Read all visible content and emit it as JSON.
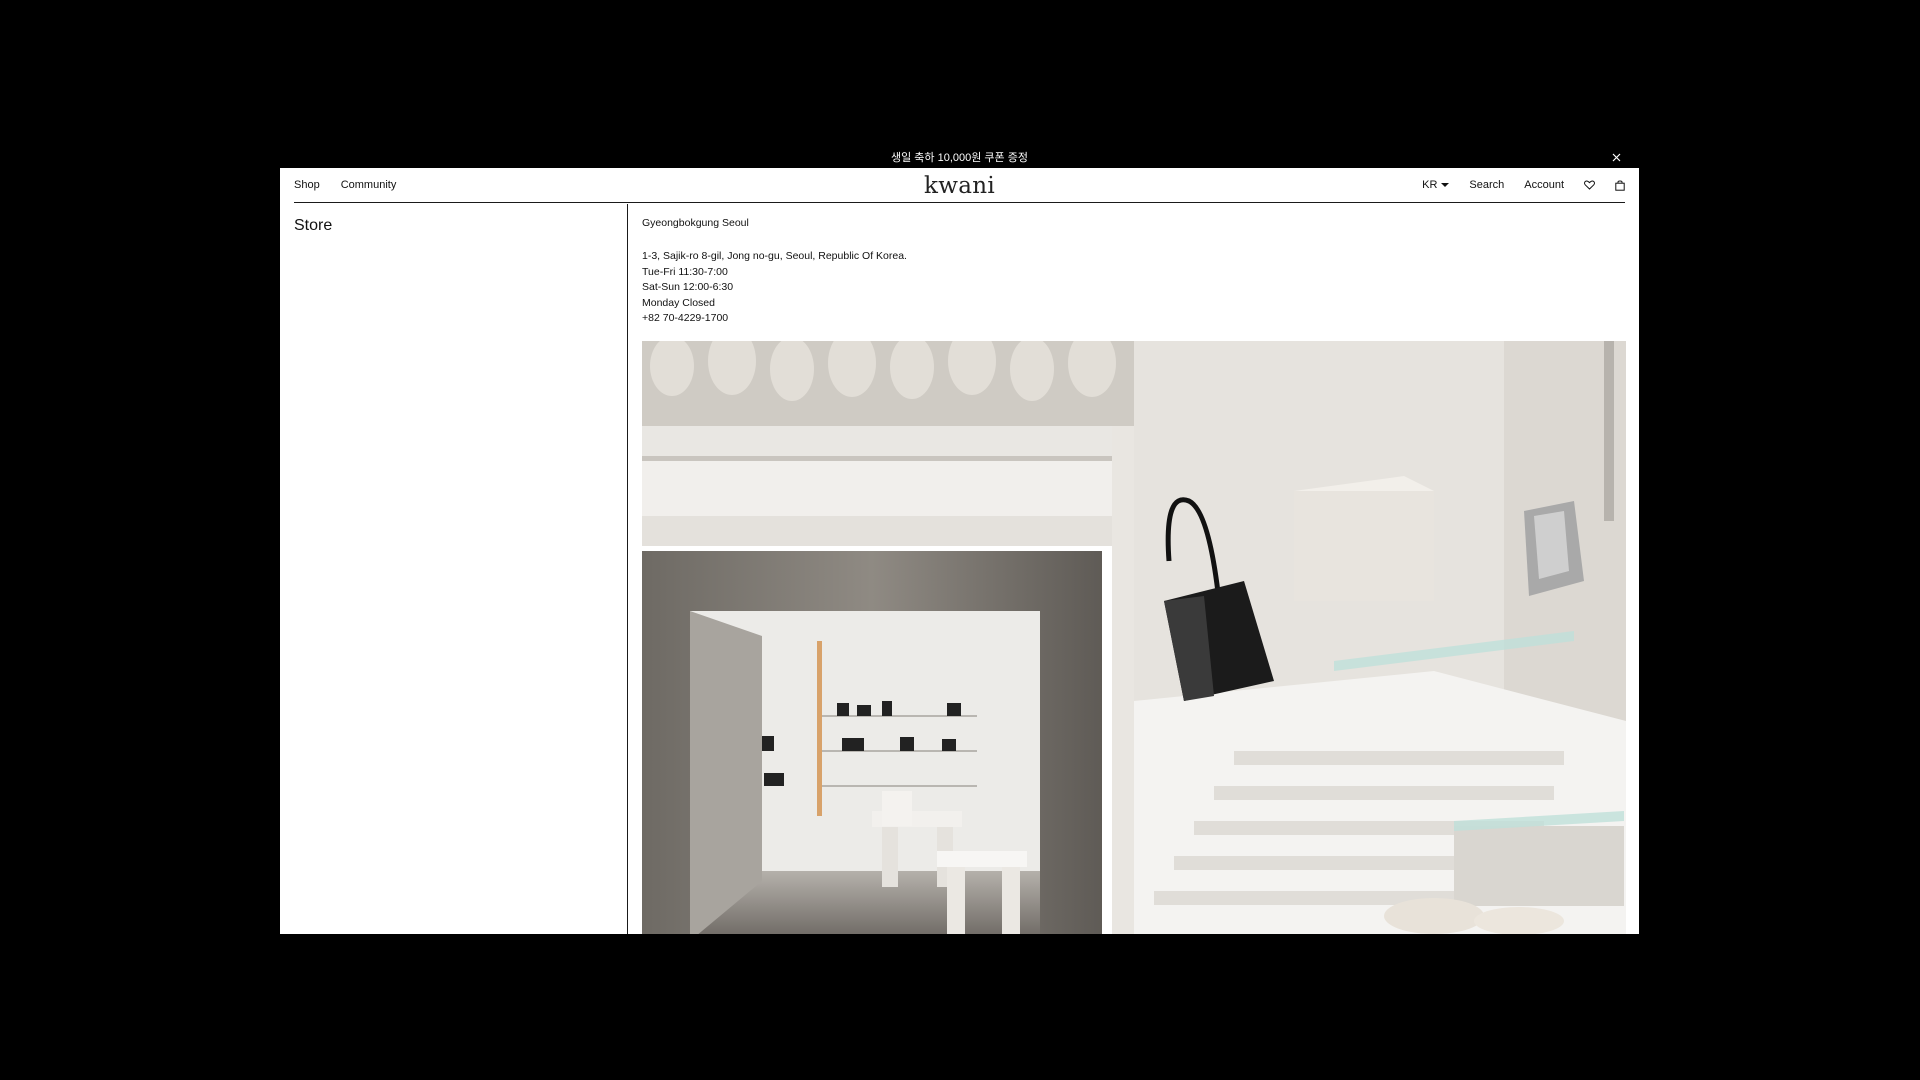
{
  "announcement": {
    "text": "생일 축하 10,000원 쿠폰 증정",
    "close_icon": "close-icon"
  },
  "header": {
    "nav_left": [
      {
        "label": "Shop"
      },
      {
        "label": "Community"
      }
    ],
    "logo": "kwani",
    "language": "KR",
    "search_label": "Search",
    "account_label": "Account",
    "wishlist_icon": "heart-icon",
    "cart_icon": "shopping-bag-icon"
  },
  "sidebar": {
    "title": "Store"
  },
  "store": {
    "name": "Gyeongbokgung Seoul",
    "address": "1-3, Sajik-ro 8-gil, Jong no-gu, Seoul, Republic Of Korea.",
    "hours_weekday": "Tue-Fri 11:30-7:00",
    "hours_weekend": "Sat-Sun 12:00-6:30",
    "closed": "Monday Closed",
    "phone": "+82 70-4229-1700"
  },
  "colors": {
    "background": "#000000",
    "panel": "#ffffff",
    "text": "#111111"
  }
}
